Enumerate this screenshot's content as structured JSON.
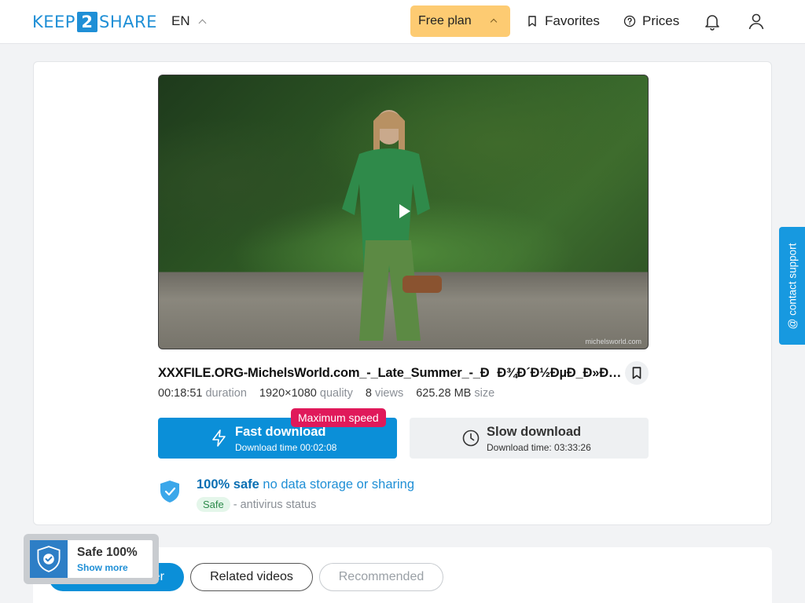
{
  "header": {
    "logo_left": "KEEP",
    "logo_num": "2",
    "logo_right": "SHARE",
    "lang": "EN",
    "plan": "Free plan",
    "favorites": "Favorites",
    "prices": "Prices"
  },
  "file": {
    "name": "XXXFILE.ORG-MichelsWorld.com_-_Late_Summer_-_ÐÐ¾Ð´Ð½ÐµÐ_Ð»Ðµ_Ð»ÐµÑÐ¾",
    "duration": "00:18:51",
    "duration_label": "duration",
    "quality": "1920×1080",
    "quality_label": "quality",
    "views": "8",
    "views_label": "views",
    "size": "625.28 MB",
    "size_label": "size",
    "watermark": "michelsworld.com"
  },
  "download": {
    "fast_title": "Fast download",
    "fast_time": "Download time 00:02:08",
    "max_speed": "Maximum speed",
    "slow_title": "Slow download",
    "slow_time": "Download time: 03:33:26"
  },
  "safety": {
    "bold": "100% safe",
    "rest": "no data storage or sharing",
    "badge": "Safe",
    "status": "- antivirus status"
  },
  "support": "@ contact support",
  "tabs": {
    "partner": "From this partner",
    "related": "Related videos",
    "recommended": "Recommended"
  },
  "safe_popup": {
    "title": "Safe 100%",
    "link": "Show more"
  },
  "colors": {
    "brand": "#1f8fd6",
    "plan": "#fdcb72",
    "fast": "#0b8fd8",
    "max_speed": "#e0195a"
  }
}
